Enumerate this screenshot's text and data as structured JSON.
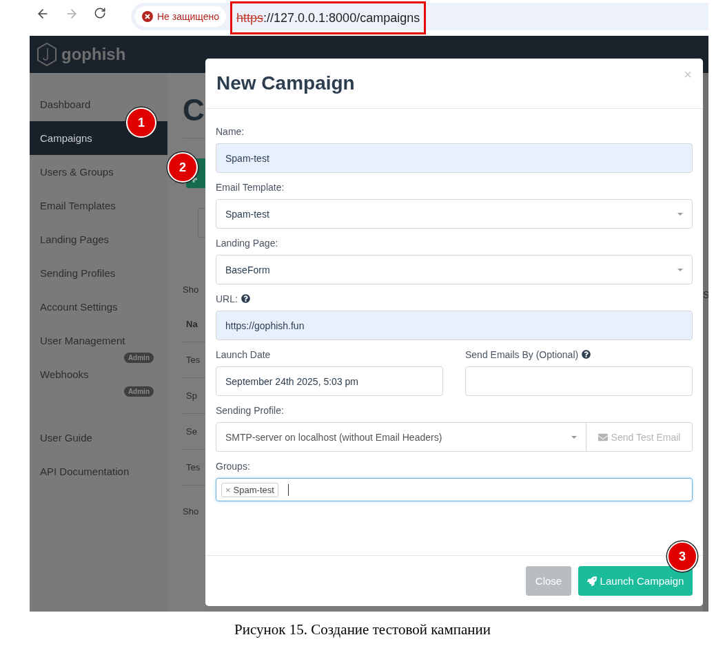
{
  "browser": {
    "security_label": "Не защищено",
    "url_scheme": "https",
    "url_rest": "://127.0.0.1:8000/campaigns",
    "url_highlighted": true
  },
  "navbar": {
    "logo": "gophish"
  },
  "sidebar": {
    "items": [
      {
        "label": "Dashboard",
        "selected": false
      },
      {
        "label": "Campaigns",
        "selected": true
      },
      {
        "label": "Users & Groups",
        "selected": false
      },
      {
        "label": "Email Templates",
        "selected": false
      },
      {
        "label": "Landing Pages",
        "selected": false
      },
      {
        "label": "Sending Profiles",
        "selected": false
      },
      {
        "label": "Account Settings",
        "selected": false
      },
      {
        "label": "User Management",
        "selected": false,
        "badge": "Admin"
      },
      {
        "label": "Webhooks",
        "selected": false,
        "badge": "Admin"
      }
    ],
    "links": [
      "User Guide",
      "API Documentation"
    ]
  },
  "page_behind": {
    "heading": "C",
    "show_entries": "Sho",
    "table_header": "Na",
    "rows": [
      "Tes",
      "Sp",
      "Se",
      "Tes"
    ],
    "footer": "Sho",
    "right_edge": "S"
  },
  "modal": {
    "title": "New Campaign",
    "close": "×",
    "name": {
      "label": "Name:",
      "value": "Spam-test"
    },
    "email_template": {
      "label": "Email Template:",
      "value": "Spam-test"
    },
    "landing_page": {
      "label": "Landing Page:",
      "value": "BaseForm"
    },
    "url": {
      "label": "URL:",
      "value": "https://gophish.fun"
    },
    "launch_date": {
      "label": "Launch Date",
      "value": "September 24th 2025, 5:03 pm"
    },
    "send_by": {
      "label": "Send Emails By (Optional)"
    },
    "sending_profile": {
      "label": "Sending Profile:",
      "value": "SMTP-server on localhost (without Email Headers)",
      "test_button": "Send Test Email"
    },
    "groups": {
      "label": "Groups:",
      "tags": [
        {
          "remove": "×",
          "label": "Spam-test"
        }
      ]
    },
    "buttons": {
      "close": "Close",
      "launch": "Launch Campaign"
    }
  },
  "annotations": [
    "1",
    "2",
    "3"
  ],
  "caption": "Рисунок 15. Создание тестовой кампании"
}
